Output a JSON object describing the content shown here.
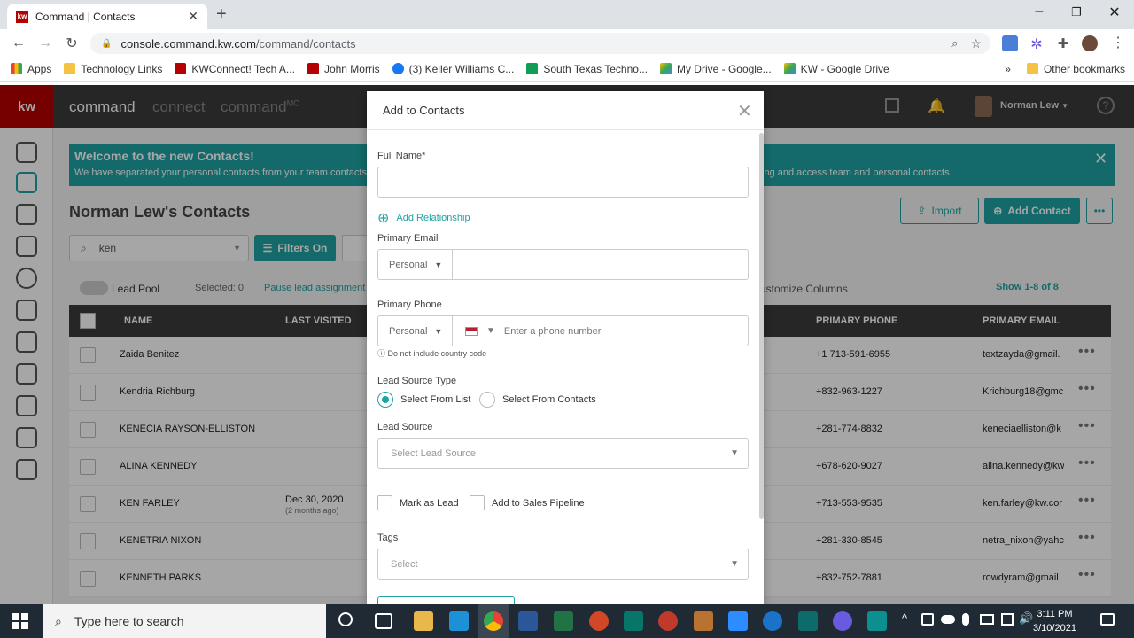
{
  "browser": {
    "tab_title": "Command | Contacts",
    "url_host": "console.command.kw.com",
    "url_path": "/command/contacts",
    "bookmarks": [
      "Apps",
      "Technology Links",
      "KWConnect! Tech A...",
      "John Morris",
      "(3) Keller Williams C...",
      "South Texas Techno...",
      "My Drive - Google...",
      "KW - Google Drive"
    ],
    "other_bookmarks": "Other bookmarks"
  },
  "app": {
    "logo": "kw",
    "nav": [
      "command",
      "connect",
      "command"
    ],
    "nav_sup": "MC",
    "user": "Norman Lew",
    "banner_title": "Welcome to the new Contacts!",
    "banner_text_left": "We have separated your personal contacts from your team contacts",
    "banner_text_right": "ing and access team and personal contacts.",
    "page_title": "Norman Lew's Contacts",
    "search_value": "ken",
    "filters_label": "Filters On",
    "import_label": "Import",
    "add_contact_label": "Add Contact",
    "lead_pool_label": "Lead Pool",
    "selected_label": "Selected: 0",
    "pause_label": "Pause lead assignment",
    "customize_label": "ustomize Columns",
    "show_label": "Show 1-8 of 8",
    "columns": [
      "NAME",
      "LAST VISITED",
      "PRIMARY PHONE",
      "PRIMARY EMAIL"
    ],
    "rows": [
      {
        "name": "Zaida Benitez",
        "visited": "",
        "visited_sub": "",
        "phone": "+1 713-591-6955",
        "email": "textzayda@gmail."
      },
      {
        "name": "Kendria Richburg",
        "visited": "",
        "visited_sub": "",
        "phone": "+832-963-1227",
        "email": "Krichburg18@gmc"
      },
      {
        "name": "KENECIA RAYSON-ELLISTON",
        "visited": "",
        "visited_sub": "",
        "phone": "+281-774-8832",
        "email": "keneciaelliston@k"
      },
      {
        "name": "ALINA KENNEDY",
        "visited": "",
        "visited_sub": "",
        "phone": "+678-620-9027",
        "email": "alina.kennedy@kw"
      },
      {
        "name": "KEN FARLEY",
        "visited": "Dec 30, 2020",
        "visited_sub": "(2 months ago)",
        "phone": "+713-553-9535",
        "email": "ken.farley@kw.cor"
      },
      {
        "name": "KENETRIA NIXON",
        "visited": "",
        "visited_sub": "",
        "phone": "+281-330-8545",
        "email": "netra_nixon@yahc"
      },
      {
        "name": "KENNETH PARKS",
        "visited": "",
        "visited_sub": "",
        "phone": "+832-752-7881",
        "email": "rowdyram@gmail."
      }
    ]
  },
  "modal": {
    "title": "Add to Contacts",
    "full_name_label": "Full Name*",
    "full_name_value": "",
    "add_relationship": "Add Relationship",
    "email_label": "Primary Email",
    "email_type": "Personal",
    "phone_label": "Primary Phone",
    "phone_type": "Personal",
    "phone_placeholder": "Enter a phone number",
    "phone_hint": "Do not include country code",
    "lead_source_type_label": "Lead Source Type",
    "radio_list": "Select From List",
    "radio_contacts": "Select From Contacts",
    "lead_source_label": "Lead Source",
    "lead_source_placeholder": "Select Lead Source",
    "mark_lead": "Mark as Lead",
    "add_pipeline": "Add to Sales Pipeline",
    "tags_label": "Tags",
    "tags_placeholder": "Select"
  },
  "taskbar": {
    "search_placeholder": "Type here to search",
    "time": "3:11 PM",
    "date": "3/10/2021"
  },
  "colors": {
    "teal": "#1fa3a3",
    "kw_red": "#b40101",
    "nav_dark": "#3b3b3b"
  }
}
